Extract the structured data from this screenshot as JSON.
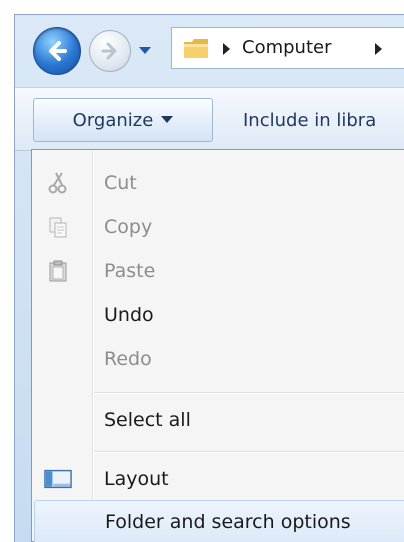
{
  "address": {
    "path_segment": "Computer"
  },
  "toolbar": {
    "organize_label": "Organize",
    "include_label": "Include in libra"
  },
  "menu": {
    "items": [
      {
        "label": "Cut",
        "icon": "scissors-icon",
        "enabled": false
      },
      {
        "label": "Copy",
        "icon": "copy-icon",
        "enabled": false
      },
      {
        "label": "Paste",
        "icon": "paste-icon",
        "enabled": false
      },
      {
        "label": "Undo",
        "icon": "",
        "enabled": true
      },
      {
        "label": "Redo",
        "icon": "",
        "enabled": false
      },
      {
        "label": "Select all",
        "icon": "",
        "enabled": true
      },
      {
        "label": "Layout",
        "icon": "layout-icon",
        "enabled": true
      },
      {
        "label": "Folder and search options",
        "icon": "",
        "enabled": true,
        "hovered": true
      }
    ]
  },
  "colors": {
    "accent": "#2a76d2",
    "menu_bg": "#f5f5f5",
    "disabled_text": "#8d8d8d",
    "toolbar_text": "#1e395b"
  }
}
